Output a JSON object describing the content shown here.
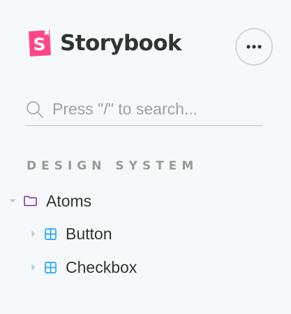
{
  "brand": {
    "logo_letter": "S",
    "name": "Storybook",
    "logo_color": "#ff4785"
  },
  "menu": {
    "icon": "ellipsis-icon"
  },
  "search": {
    "placeholder": "Press \"/\" to search...",
    "value": ""
  },
  "sidebar": {
    "section_heading": "DESIGN SYSTEM",
    "tree": [
      {
        "label": "Atoms",
        "type": "group",
        "icon": "folder-icon",
        "expanded": true,
        "icon_color": "#6f2cac",
        "children": [
          {
            "label": "Button",
            "type": "component",
            "icon": "component-icon",
            "expanded": false,
            "icon_color": "#1ea7fd"
          },
          {
            "label": "Checkbox",
            "type": "component",
            "icon": "component-icon",
            "expanded": false,
            "icon_color": "#1ea7fd"
          }
        ]
      }
    ]
  },
  "colors": {
    "background": "#f6f9fc",
    "text": "#333333",
    "muted_text": "#999999",
    "divider": "#d7dbe0"
  }
}
